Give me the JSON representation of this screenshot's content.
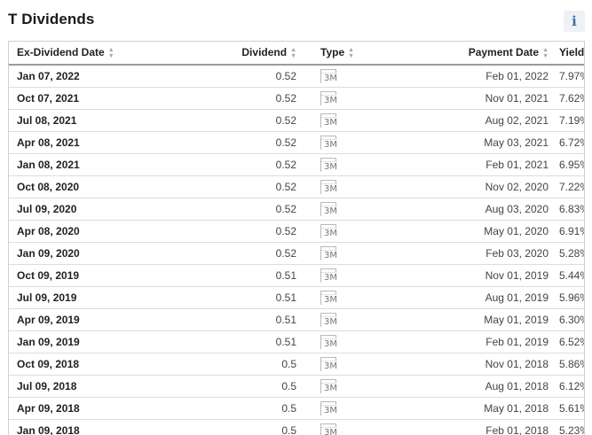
{
  "page": {
    "title": "T Dividends",
    "info_label": "i"
  },
  "table": {
    "columns": [
      {
        "key": "ex_date",
        "label": "Ex-Dividend Date"
      },
      {
        "key": "dividend",
        "label": "Dividend"
      },
      {
        "key": "type",
        "label": "Type"
      },
      {
        "key": "payment_date",
        "label": "Payment Date"
      },
      {
        "key": "yield",
        "label": "Yield"
      }
    ],
    "type_icon": "calendar-icon",
    "rows": [
      {
        "ex_date": "Jan 07, 2022",
        "dividend": "0.52",
        "type": "3M",
        "payment_date": "Feb 01, 2022",
        "yield": "7.97%"
      },
      {
        "ex_date": "Oct 07, 2021",
        "dividend": "0.52",
        "type": "3M",
        "payment_date": "Nov 01, 2021",
        "yield": "7.62%"
      },
      {
        "ex_date": "Jul 08, 2021",
        "dividend": "0.52",
        "type": "3M",
        "payment_date": "Aug 02, 2021",
        "yield": "7.19%"
      },
      {
        "ex_date": "Apr 08, 2021",
        "dividend": "0.52",
        "type": "3M",
        "payment_date": "May 03, 2021",
        "yield": "6.72%"
      },
      {
        "ex_date": "Jan 08, 2021",
        "dividend": "0.52",
        "type": "3M",
        "payment_date": "Feb 01, 2021",
        "yield": "6.95%"
      },
      {
        "ex_date": "Oct 08, 2020",
        "dividend": "0.52",
        "type": "3M",
        "payment_date": "Nov 02, 2020",
        "yield": "7.22%"
      },
      {
        "ex_date": "Jul 09, 2020",
        "dividend": "0.52",
        "type": "3M",
        "payment_date": "Aug 03, 2020",
        "yield": "6.83%"
      },
      {
        "ex_date": "Apr 08, 2020",
        "dividend": "0.52",
        "type": "3M",
        "payment_date": "May 01, 2020",
        "yield": "6.91%"
      },
      {
        "ex_date": "Jan 09, 2020",
        "dividend": "0.52",
        "type": "3M",
        "payment_date": "Feb 03, 2020",
        "yield": "5.28%"
      },
      {
        "ex_date": "Oct 09, 2019",
        "dividend": "0.51",
        "type": "3M",
        "payment_date": "Nov 01, 2019",
        "yield": "5.44%"
      },
      {
        "ex_date": "Jul 09, 2019",
        "dividend": "0.51",
        "type": "3M",
        "payment_date": "Aug 01, 2019",
        "yield": "5.96%"
      },
      {
        "ex_date": "Apr 09, 2019",
        "dividend": "0.51",
        "type": "3M",
        "payment_date": "May 01, 2019",
        "yield": "6.30%"
      },
      {
        "ex_date": "Jan 09, 2019",
        "dividend": "0.51",
        "type": "3M",
        "payment_date": "Feb 01, 2019",
        "yield": "6.52%"
      },
      {
        "ex_date": "Oct 09, 2018",
        "dividend": "0.5",
        "type": "3M",
        "payment_date": "Nov 01, 2018",
        "yield": "5.86%"
      },
      {
        "ex_date": "Jul 09, 2018",
        "dividend": "0.5",
        "type": "3M",
        "payment_date": "Aug 01, 2018",
        "yield": "6.12%"
      },
      {
        "ex_date": "Apr 09, 2018",
        "dividend": "0.5",
        "type": "3M",
        "payment_date": "May 01, 2018",
        "yield": "5.61%"
      },
      {
        "ex_date": "Jan 09, 2018",
        "dividend": "0.5",
        "type": "3M",
        "payment_date": "Feb 01, 2018",
        "yield": "5.23%"
      }
    ]
  }
}
